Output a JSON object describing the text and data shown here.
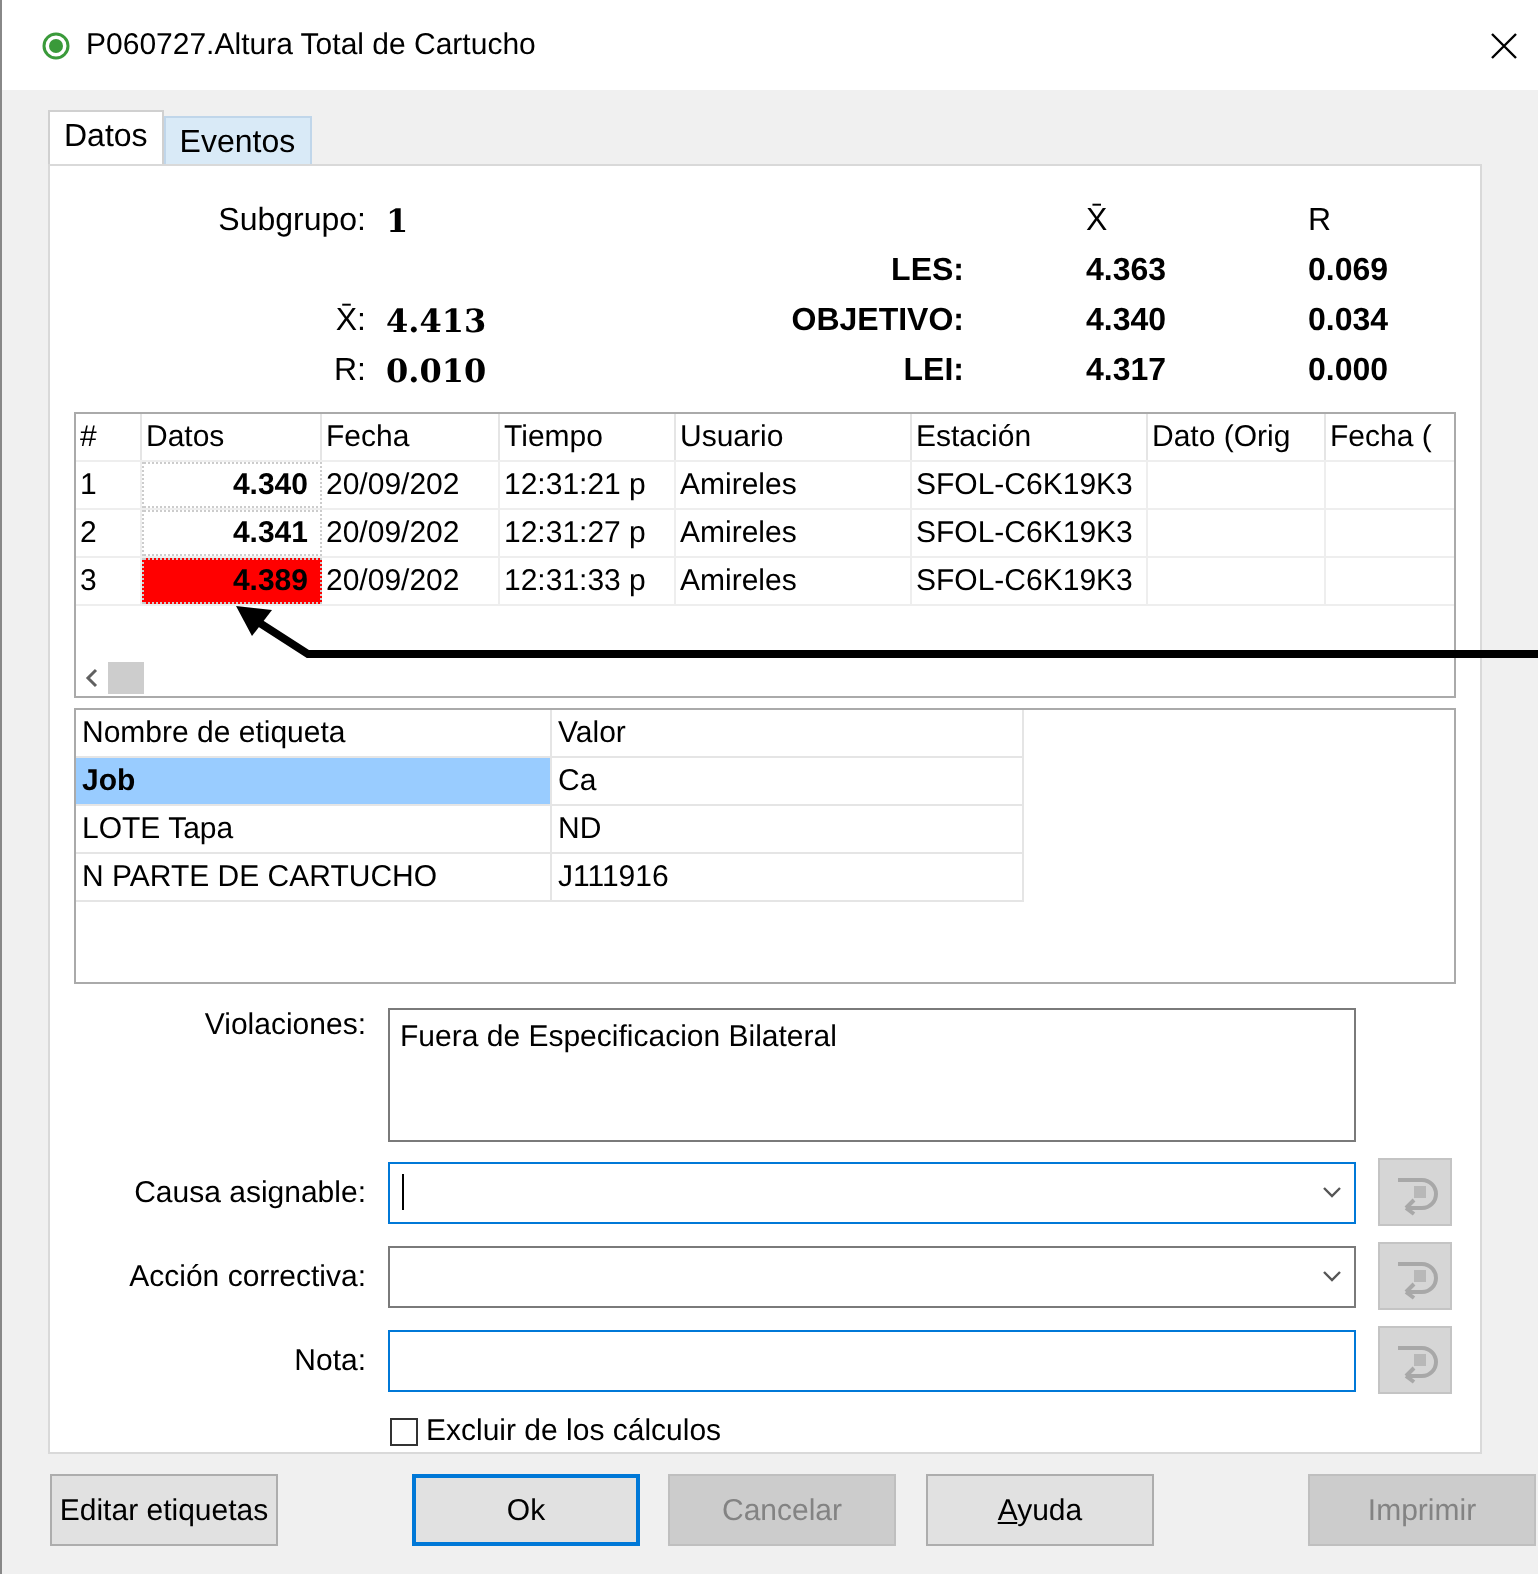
{
  "window": {
    "title": "P060727.Altura Total de Cartucho"
  },
  "tabs": [
    {
      "label": "Datos",
      "selected": true
    },
    {
      "label": "Eventos",
      "selected": false
    }
  ],
  "summary": {
    "subgroup_label": "Subgrupo:",
    "subgroup": "1",
    "xbar_label": "X̄:",
    "xbar": "4.413",
    "r_label": "R:",
    "r": "0.010"
  },
  "limits": {
    "columns": [
      "X̄",
      "R"
    ],
    "rows": [
      {
        "label": "LES:",
        "xbar": "4.363",
        "r": "0.069"
      },
      {
        "label": "OBJETIVO:",
        "xbar": "4.340",
        "r": "0.034"
      },
      {
        "label": "LEI:",
        "xbar": "4.317",
        "r": "0.000"
      }
    ]
  },
  "data_table": {
    "columns": [
      "#",
      "Datos",
      "Fecha",
      "Tiempo",
      "Usuario",
      "Estación",
      "Dato (Orig",
      "Fecha ("
    ],
    "rows": [
      {
        "cells": [
          "1",
          "4.340",
          "20/09/202",
          "12:31:21 p",
          "Amireles",
          "SFOL-C6K19K3"
        ],
        "out_of_spec": false
      },
      {
        "cells": [
          "2",
          "4.341",
          "20/09/202",
          "12:31:27 p",
          "Amireles",
          "SFOL-C6K19K3"
        ],
        "out_of_spec": false
      },
      {
        "cells": [
          "3",
          "4.389",
          "20/09/202",
          "12:31:33 p",
          "Amireles",
          "SFOL-C6K19K3"
        ],
        "out_of_spec": true
      }
    ]
  },
  "tags_table": {
    "columns": [
      "Nombre de etiqueta",
      "Valor"
    ],
    "rows": [
      {
        "name": "Job",
        "value": "Ca",
        "selected": true
      },
      {
        "name": "LOTE Tapa",
        "value": "ND",
        "selected": false
      },
      {
        "name": "N PARTE DE CARTUCHO",
        "value": "J111916",
        "selected": false
      }
    ]
  },
  "violations": {
    "label": "Violaciones:",
    "text": "Fuera de Especificacion Bilateral"
  },
  "fields": [
    {
      "label": "Causa asignable:",
      "kind": "combo",
      "active": true,
      "caret": true
    },
    {
      "label": "Acción correctiva:",
      "kind": "combo",
      "active": false,
      "caret": false
    },
    {
      "label": "Nota:",
      "kind": "text",
      "active": true,
      "caret": false
    }
  ],
  "exclude": {
    "label": "Excluir de los cálculos",
    "checked": false
  },
  "buttons": [
    {
      "parts": [
        {
          "text": "Editar etiquetas",
          "underline": false
        }
      ],
      "disabled": false,
      "default": false
    },
    {
      "parts": [
        {
          "text": "Ok",
          "underline": false
        }
      ],
      "disabled": false,
      "default": true
    },
    {
      "parts": [
        {
          "text": "Cancelar",
          "underline": false
        }
      ],
      "disabled": true,
      "default": false
    },
    {
      "parts": [
        {
          "text": "A",
          "underline": true
        },
        {
          "text": "yuda",
          "underline": false
        }
      ],
      "disabled": false,
      "default": false
    },
    {
      "parts": [
        {
          "text": "Imprimir",
          "underline": false
        }
      ],
      "disabled": true,
      "default": false
    }
  ]
}
